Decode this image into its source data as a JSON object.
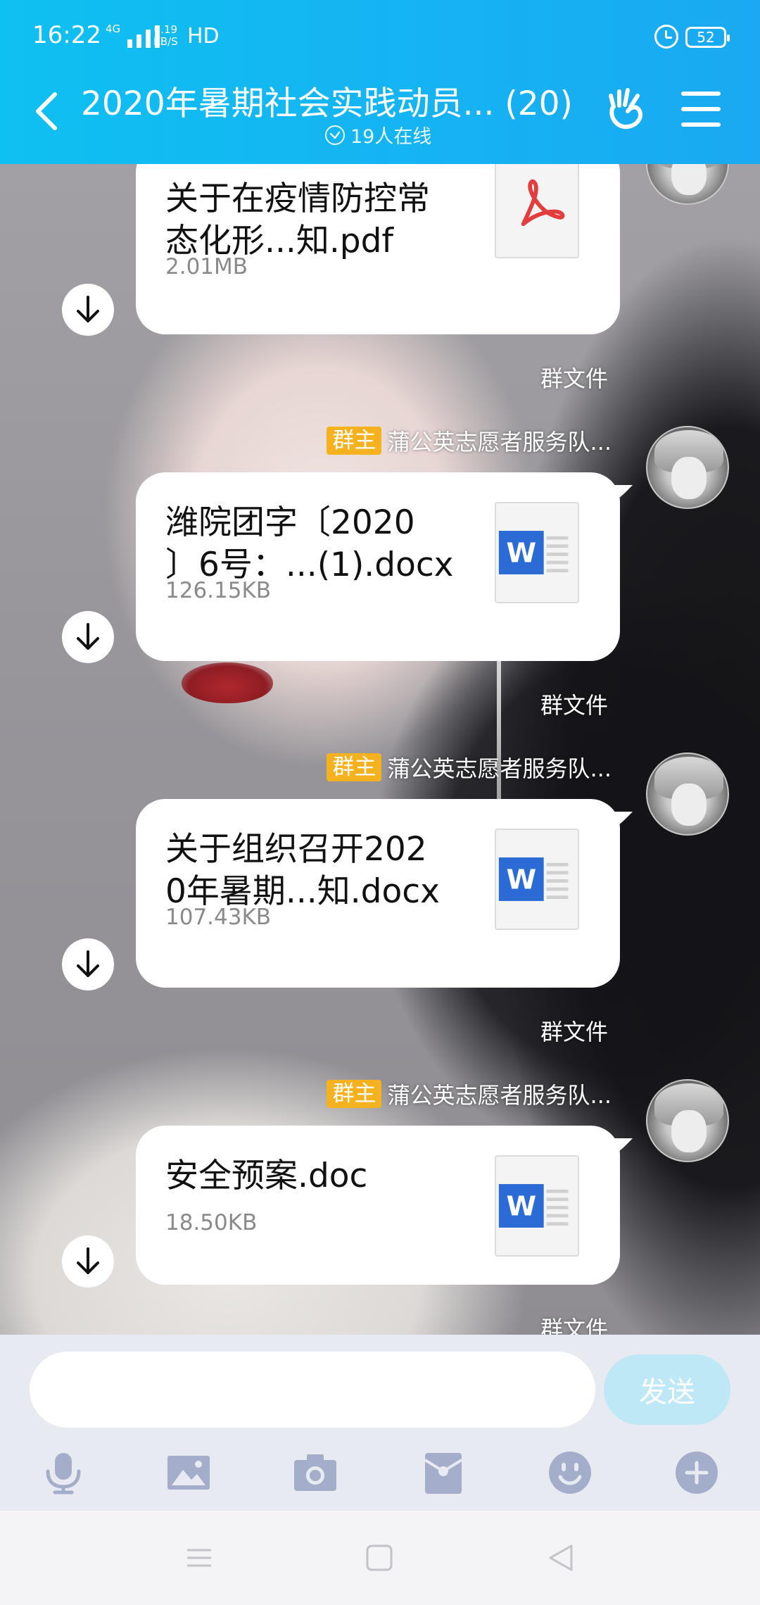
{
  "status_bar": {
    "time": "16:22",
    "network": "4G",
    "speed_value": "0.19",
    "speed_unit": "KB/S",
    "hd": "HD",
    "battery": "52"
  },
  "header": {
    "title": "2020年暑期社会实践动员... (20)",
    "online": "19人在线"
  },
  "messages": [
    {
      "file_name": "关于在疫情防控常\n态化形...知.pdf",
      "file_size": "2.01MB",
      "file_type": "pdf-icon",
      "caption": "群文件"
    },
    {
      "badge": "群主",
      "sender": "蒲公英志愿者服务队...",
      "file_name": "潍院团字〔2020\n〕6号：...(1).docx",
      "file_size": "126.15KB",
      "file_type": "word-icon",
      "caption": "群文件"
    },
    {
      "badge": "群主",
      "sender": "蒲公英志愿者服务队...",
      "file_name": "关于组织召开202\n0年暑期...知.docx",
      "file_size": "107.43KB",
      "file_type": "word-icon",
      "caption": "群文件"
    },
    {
      "badge": "群主",
      "sender": "蒲公英志愿者服务队...",
      "file_name": "安全预案.doc",
      "file_size": "18.50KB",
      "file_type": "word-icon",
      "caption": "群文件"
    }
  ],
  "input": {
    "placeholder": "",
    "send_label": "发送"
  },
  "toolbar": [
    "microphone-icon",
    "image-icon",
    "camera-icon",
    "red-packet-icon",
    "emoji-icon",
    "plus-icon"
  ],
  "colors": {
    "header_start": "#0fc0f2",
    "header_end": "#1aa9f2",
    "owner_badge": "#f5b21e",
    "word_blue": "#2b6bd6",
    "pdf_red": "#e33d3d",
    "send_button": "#bfe8f7",
    "toolbar_icon": "#a4adca"
  }
}
